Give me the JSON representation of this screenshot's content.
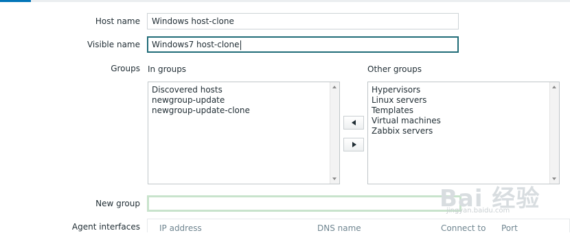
{
  "form": {
    "host_name": {
      "label": "Host name",
      "value": "Windows host-clone"
    },
    "visible_name": {
      "label": "Visible name",
      "value": "Windows7 host-clone"
    },
    "groups": {
      "label": "Groups",
      "in_groups_label": "In groups",
      "in_groups": [
        "Discovered hosts",
        "newgroup-update",
        "newgroup-update-clone"
      ],
      "other_groups_label": "Other groups",
      "other_groups": [
        "Hypervisors",
        "Linux servers",
        "Templates",
        "Virtual machines",
        "Zabbix servers"
      ]
    },
    "new_group": {
      "label": "New group",
      "value": ""
    },
    "agent_interfaces": {
      "label": "Agent interfaces",
      "columns": [
        "IP address",
        "DNS name",
        "Connect to",
        "Port"
      ]
    }
  },
  "watermark": {
    "main": "Bai 经验",
    "sub": "jingyan.baidu.com"
  },
  "colors": {
    "accent": "#0275b8",
    "focus_border": "#1f6b77",
    "new_group_border": "#c8e3cc"
  }
}
